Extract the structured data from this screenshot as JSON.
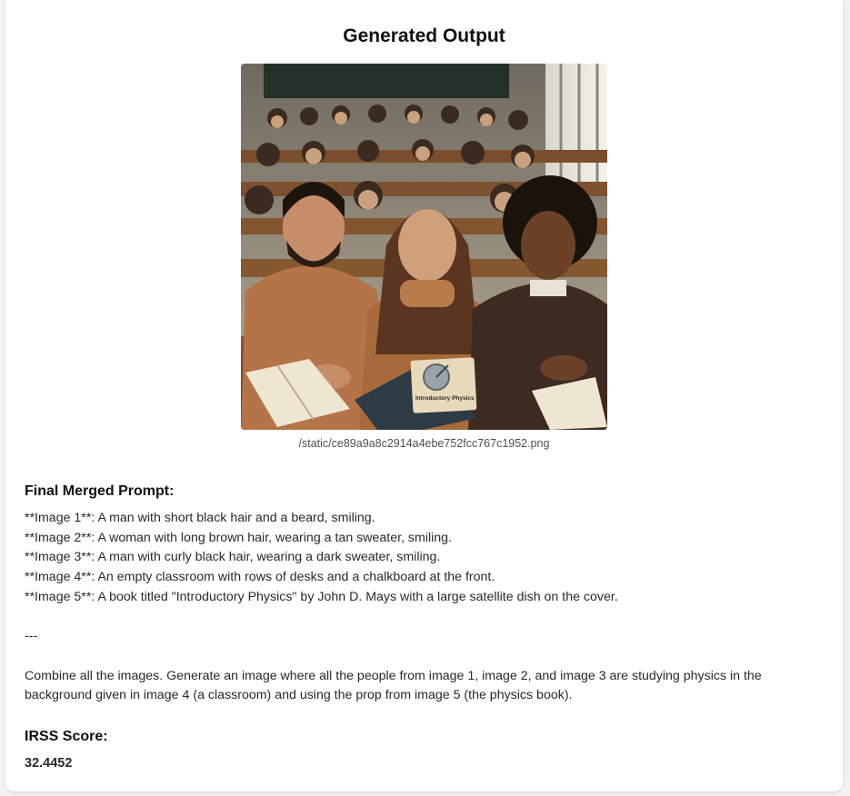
{
  "header": {
    "title": "Generated Output"
  },
  "output_image": {
    "caption": "/static/ce89a9a8c2914a4ebe752fcc767c1952.png",
    "book_cover_text": "Introductory Physics"
  },
  "prompt_section": {
    "heading": "Final Merged Prompt:",
    "lines": [
      "**Image 1**: A man with short black hair and a beard, smiling.",
      "**Image 2**: A woman with long brown hair, wearing a tan sweater, smiling.",
      "**Image 3**: A man with curly black hair, wearing a dark sweater, smiling.",
      "**Image 4**: An empty classroom with rows of desks and a chalkboard at the front.",
      "**Image 5**: A book titled \"Introductory Physics\" by John D. Mays with a large satellite dish on the cover."
    ],
    "separator": "---",
    "instruction_line_1": "Combine all the images. Generate an image where all the people from image 1, image 2, and image 3 are studying physics in the",
    "instruction_line_2": "background given in image 4 (a classroom) and using the prop from image 5 (the physics book)."
  },
  "score_section": {
    "heading": "IRSS Score:",
    "value": "32.4452"
  }
}
